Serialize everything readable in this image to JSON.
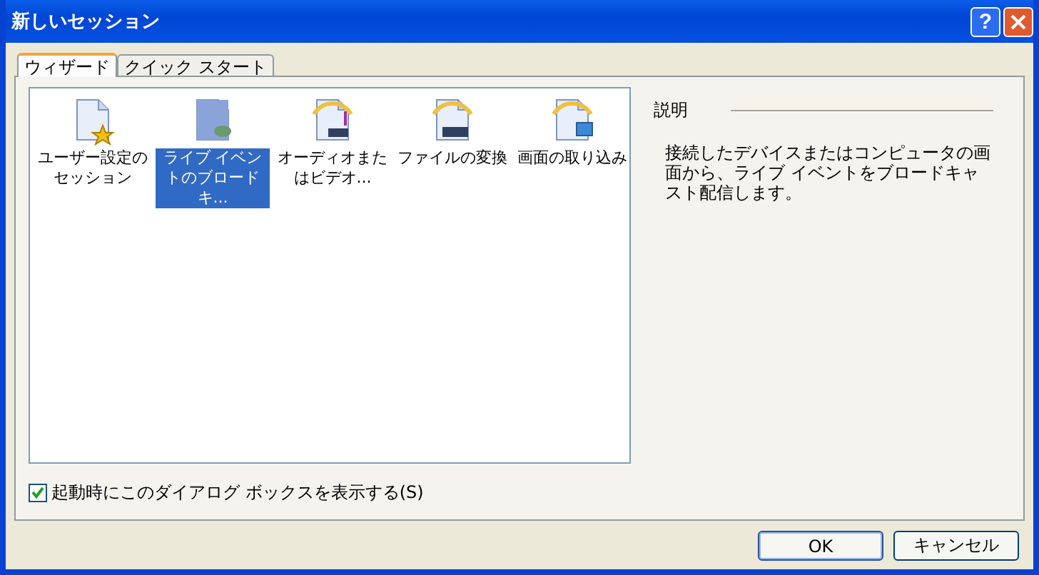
{
  "window": {
    "title": "新しいセッション",
    "help_button": "?"
  },
  "tabs": [
    {
      "label": "ウィザード",
      "selected": true
    },
    {
      "label": "クイック スタート",
      "selected": false
    }
  ],
  "items": [
    {
      "kind": "custom",
      "label": "ユーザー設定のセッション",
      "selected": false
    },
    {
      "kind": "broadcast",
      "label": "ライブ イベントのブロードキ...",
      "selected": true
    },
    {
      "kind": "audio",
      "label": "オーディオまたはビデオ...",
      "selected": false
    },
    {
      "kind": "convert",
      "label": "ファイルの変換",
      "selected": false
    },
    {
      "kind": "capture",
      "label": "画面の取り込み",
      "selected": false
    }
  ],
  "description": {
    "heading": "説明",
    "text": "接続したデバイスまたはコンピュータの画面から、ライブ イベントをブロードキャスト配信します。"
  },
  "startup_checkbox": {
    "label": "起動時にこのダイアログ ボックスを表示する(S)",
    "checked": true
  },
  "buttons": [
    {
      "label": "OK",
      "default": true
    },
    {
      "label": "キャンセル",
      "default": false
    }
  ]
}
